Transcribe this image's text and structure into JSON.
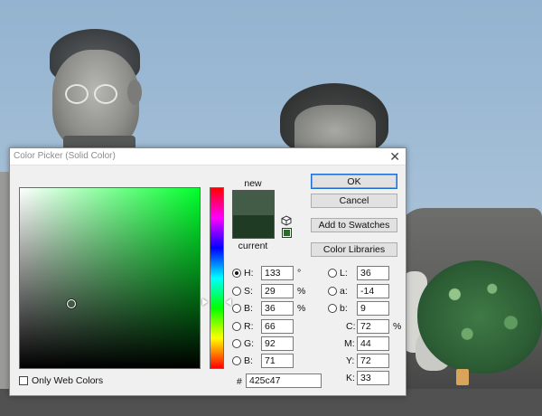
{
  "dialog": {
    "title": "Color Picker (Solid Color)",
    "close_glyph": "✕"
  },
  "preview": {
    "new_label": "new",
    "current_label": "current",
    "new_color": "#425c47",
    "current_color": "#1f3b24"
  },
  "buttons": {
    "ok": "OK",
    "cancel": "Cancel",
    "add_to_swatches": "Add to Swatches",
    "color_libraries": "Color Libraries"
  },
  "hsb": {
    "h_label": "H:",
    "h_value": "133",
    "h_unit": "°",
    "s_label": "S:",
    "s_value": "29",
    "s_unit": "%",
    "b_label": "B:",
    "b_value": "36",
    "b_unit": "%",
    "selected": "H"
  },
  "rgb": {
    "r_label": "R:",
    "r_value": "66",
    "g_label": "G:",
    "g_value": "92",
    "b_label": "B:",
    "b_value": "71"
  },
  "lab": {
    "l_label": "L:",
    "l_value": "36",
    "a_label": "a:",
    "a_value": "-14",
    "b_label": "b:",
    "b_value": "9"
  },
  "cmyk": {
    "c_label": "C:",
    "c_value": "72",
    "c_unit": "%",
    "m_label": "M:",
    "m_value": "44",
    "y_label": "Y:",
    "y_value": "72",
    "k_label": "K:",
    "k_value": "33"
  },
  "hex": {
    "prefix": "#",
    "value": "425c47"
  },
  "web_colors": {
    "label": "Only Web Colors",
    "checked": false
  },
  "colors": {
    "field_hue": "#00ff2c",
    "button_focus": "#1b6fcf"
  }
}
